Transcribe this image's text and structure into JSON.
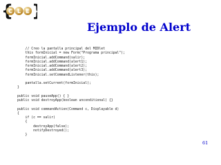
{
  "logo": {
    "letters": [
      "C",
      "L",
      "E"
    ],
    "colors": {
      "circle": "#c08a2a",
      "letter_fill": "#ffffff",
      "brace": "#111111",
      "gradient_light": "#fff3c4",
      "gradient_dark": "#b8821f"
    }
  },
  "slide": {
    "title": "Ejemplo de Alert",
    "title_color": "#0000cc",
    "page_number": "61",
    "code_lines": [
      "    // Creo la pantalla principal del MIDlet",
      "    this formInicial = new Form(\"Programa principal\");",
      "    formInicial.addCommand(salir);",
      "    formInicial.addCommand(alert1);",
      "    formInicial.addCommand(alert2);",
      "    formInicial.addCommand(alert3);",
      "    formInicial.setCommandListener(this);",
      "",
      "    pantalla.setCurrent(formInicial);",
      "}",
      "",
      "public void pauseApp() { }",
      "public void destroyApp(boolean unconditional) {}",
      "",
      "public void commandAction(Command c, Displayable d)",
      "{",
      "    if (c == salir)",
      "    {",
      "        destroyApp(false);",
      "        notifyDestroyed();",
      "    }"
    ]
  }
}
